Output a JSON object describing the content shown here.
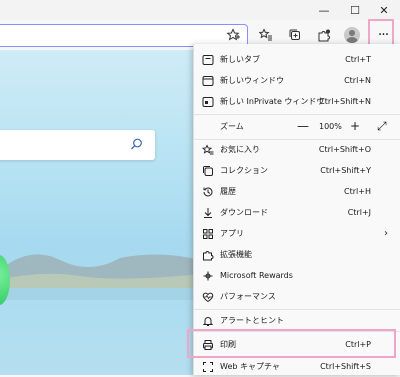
{
  "window": {
    "minimize_glyph": "—",
    "maximize_glyph": "☐",
    "close_glyph": "✕"
  },
  "toolbar": {
    "more_glyph": "···"
  },
  "menu": {
    "items": [
      {
        "label": "新しいタブ",
        "shortcut": "Ctrl+T",
        "icon": "new-tab-icon"
      },
      {
        "label": "新しいウィンドウ",
        "shortcut": "Ctrl+N",
        "icon": "new-window-icon"
      },
      {
        "label": "新しい InPrivate ウィンドウ",
        "shortcut": "Ctrl+Shift+N",
        "icon": "inprivate-icon"
      },
      {
        "label": "お気に入り",
        "shortcut": "Ctrl+Shift+O",
        "icon": "favorites-icon"
      },
      {
        "label": "コレクション",
        "shortcut": "Ctrl+Shift+Y",
        "icon": "collections-icon"
      },
      {
        "label": "履歴",
        "shortcut": "Ctrl+H",
        "icon": "history-icon"
      },
      {
        "label": "ダウンロード",
        "shortcut": "Ctrl+J",
        "icon": "download-icon"
      },
      {
        "label": "アプリ",
        "shortcut": "",
        "icon": "apps-icon",
        "submenu": "›"
      },
      {
        "label": "拡張機能",
        "shortcut": "",
        "icon": "extensions-icon"
      },
      {
        "label": "Microsoft Rewards",
        "shortcut": "",
        "icon": "rewards-icon"
      },
      {
        "label": "パフォーマンス",
        "shortcut": "",
        "icon": "performance-icon"
      },
      {
        "label": "アラートとヒント",
        "shortcut": "",
        "icon": "alerts-icon"
      },
      {
        "label": "印刷",
        "shortcut": "Ctrl+P",
        "icon": "print-icon"
      },
      {
        "label": "Web キャプチャ",
        "shortcut": "Ctrl+Shift+S",
        "icon": "web-capture-icon"
      }
    ],
    "zoom": {
      "label": "ズーム",
      "minus": "—",
      "value": "100%",
      "plus": "+",
      "fullscreen": "⤢"
    }
  }
}
